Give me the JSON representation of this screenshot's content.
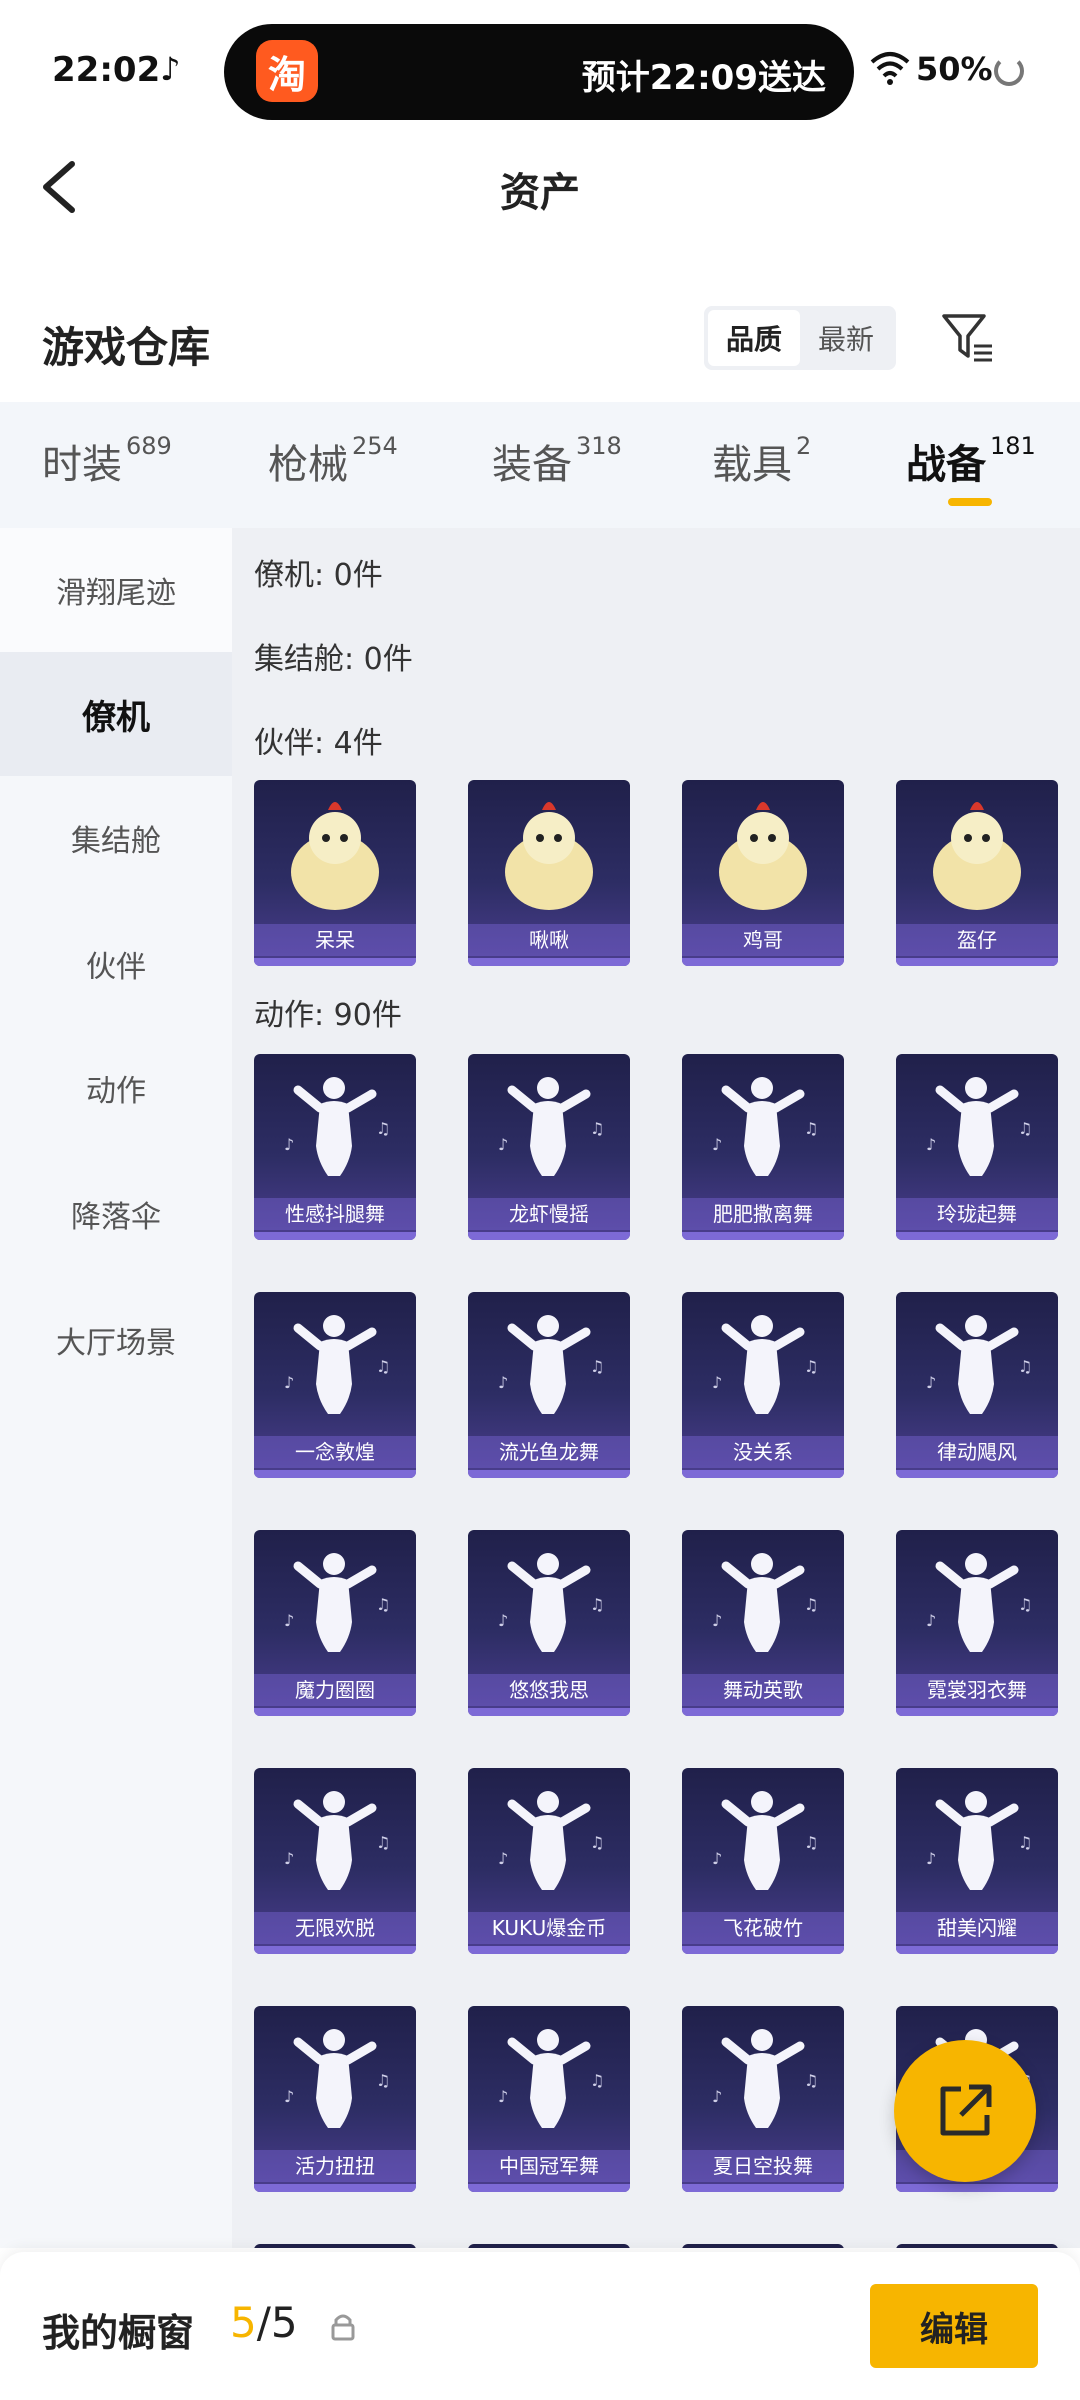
{
  "status_bar": {
    "time": "22:02",
    "tiktok_icon": "tiktok-icon",
    "taobao_icon_text": "淘",
    "delivery_text": "预计22:09送达",
    "battery": "50%"
  },
  "nav": {
    "title": "资产",
    "back_icon": "chevron-left-icon"
  },
  "section": {
    "title": "游戏仓库",
    "sort_options": [
      "品质",
      "最新"
    ],
    "sort_selected": "品质",
    "filter_icon": "filter-icon"
  },
  "category_tabs": [
    {
      "label": "时装",
      "count": "689"
    },
    {
      "label": "枪械",
      "count": "254"
    },
    {
      "label": "装备",
      "count": "318"
    },
    {
      "label": "载具",
      "count": "2"
    },
    {
      "label": "战备",
      "count": "181",
      "active": true
    }
  ],
  "side_menu": [
    "滑翔尾迹",
    "僚机",
    "集结舱",
    "伙伴",
    "动作",
    "降落伞",
    "大厅场景"
  ],
  "side_menu_active": "僚机",
  "groups": {
    "wingman": "僚机: 0件",
    "rally": "集结舱: 0件",
    "partner": "伙伴: 4件",
    "action": "动作: 90件"
  },
  "partners": [
    "呆呆",
    "啾啾",
    "鸡哥",
    "盔仔"
  ],
  "actions": [
    "性感抖腿舞",
    "龙虾慢摇",
    "肥肥撒离舞",
    "玲珑起舞",
    "一念敦煌",
    "流光鱼龙舞",
    "没关系",
    "律动飓风",
    "魔力圈圈",
    "悠悠我思",
    "舞动英歌",
    "霓裳羽衣舞",
    "无限欢脱",
    "KUKU爆金币",
    "飞花破竹",
    "甜美闪耀",
    "活力扭扭",
    "中国冠军舞",
    "夏日空投舞",
    ""
  ],
  "fab_icon": "share-icon",
  "bottom": {
    "label": "我的橱窗",
    "count_current": "5",
    "count_sep_total": "/5",
    "lock_icon": "lock-icon",
    "edit_label": "编辑"
  },
  "colors": {
    "accent": "#f7b500",
    "tile_dark": "#20204a",
    "tile_light": "#4b3e8f"
  }
}
